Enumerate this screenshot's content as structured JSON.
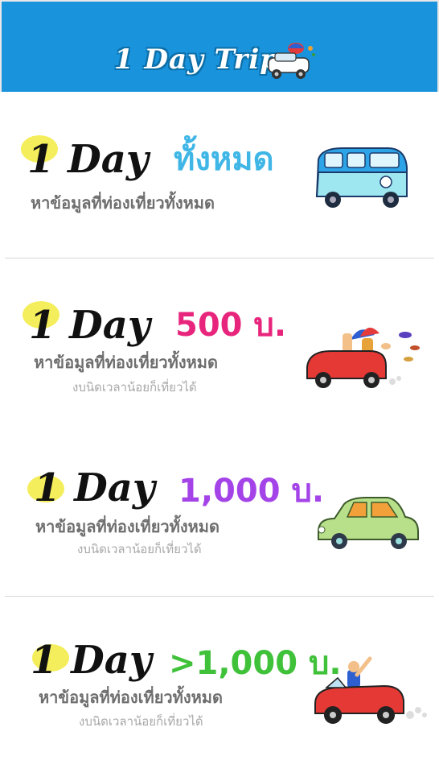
{
  "header": {
    "title": "1 Day Trip",
    "background": "#1a93dd",
    "icon": "car-icon"
  },
  "cards": [
    {
      "brand": "1 Day",
      "price": "ทั้งหมด",
      "price_color": "#3fb6e6",
      "subtitle": "หาข้อมูลที่ท่องเที่ยวทั้งหมด",
      "tagline": "",
      "icon": "van-icon"
    },
    {
      "brand": "1 Day",
      "price": "500 บ.",
      "price_color": "#e8257c",
      "subtitle": "หาข้อมูลที่ท่องเที่ยวทั้งหมด",
      "tagline": "งบนิดเวลาน้อยก็เที่ยวได้",
      "icon": "convertible-car-icon"
    },
    {
      "brand": "1 Day",
      "price": "1,000 บ.",
      "price_color": "#a444e8",
      "subtitle": "หาข้อมูลที่ท่องเที่ยวทั้งหมด",
      "tagline": "งบนิดเวลาน้อยก็เที่ยวได้",
      "icon": "sedan-car-icon"
    },
    {
      "brand": "1 Day",
      "price": ">1,000 บ.",
      "price_color": "#3fc23a",
      "subtitle": "หาข้อมูลที่ท่องเที่ยวทั้งหมด",
      "tagline": "งบนิดเวลาน้อยก็เที่ยวได้",
      "icon": "sports-car-icon"
    }
  ]
}
